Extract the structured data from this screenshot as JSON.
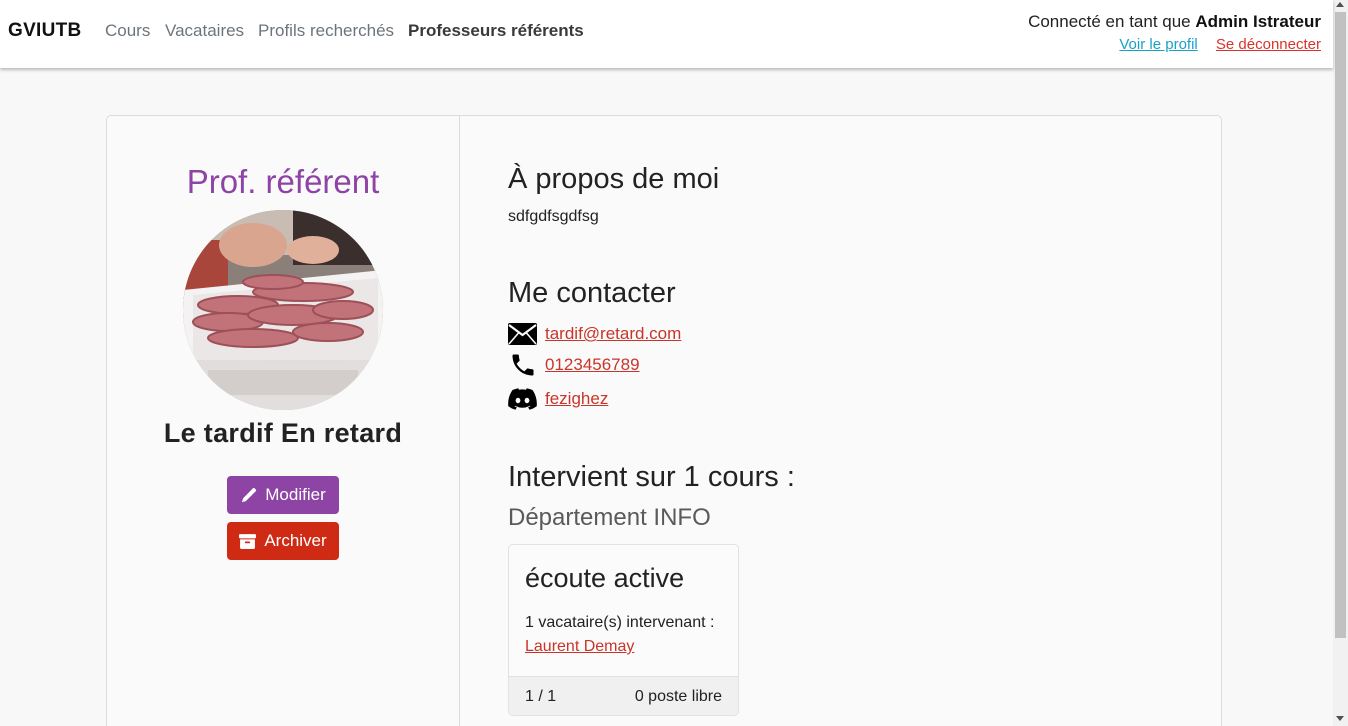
{
  "navbar": {
    "brand": "GVIUTB",
    "items": [
      {
        "label": "Cours"
      },
      {
        "label": "Vacataires"
      },
      {
        "label": "Profils recherchés"
      },
      {
        "label": "Professeurs référents"
      }
    ],
    "active_index": 3,
    "user": {
      "prefix": "Connecté en tant que ",
      "name": "Admin Istrateur",
      "profile_link": "Voir le profil",
      "logout_link": "Se déconnecter"
    }
  },
  "profile": {
    "role": "Prof. référent",
    "name": "Le tardif En retard",
    "edit_button": "Modifier",
    "archive_button": "Archiver"
  },
  "about": {
    "title": "À propos de moi",
    "text": "sdfgdfsgdfsg"
  },
  "contact": {
    "title": "Me contacter",
    "email": "tardif@retard.com",
    "phone": "0123456789",
    "discord": "fezighez"
  },
  "courses": {
    "title": "Intervient sur 1 cours :",
    "department": "Département INFO",
    "items": [
      {
        "name": "écoute active",
        "info": "1 vacataire(s) intervenant :",
        "teacher": "Laurent Demay",
        "count": "1 / 1",
        "free": "0 poste libre"
      }
    ]
  },
  "colors": {
    "accent_purple": "#8e44a5",
    "danger_red": "#cf2a14",
    "link_red": "#c8352a",
    "link_blue": "#1aa1c7"
  }
}
